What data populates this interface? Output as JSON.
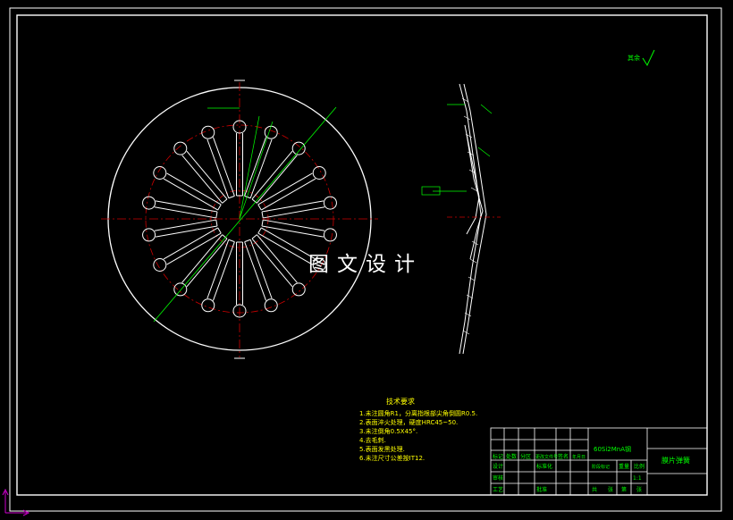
{
  "watermark": "图文设计",
  "roughness_note": "其余",
  "tech_req": {
    "title": "技术要求",
    "lines": [
      "1.未注圆角R1，分离指根部尖角倒圆R0.5.",
      "2.表面淬火处理，硬度HRC45~50.",
      "3.未注倒角0.5X45°.",
      "4.去毛刺.",
      "5.表面发黑处理.",
      "6.未注尺寸公差按IT12."
    ]
  },
  "title_block": {
    "material": "60Si2MnA钢",
    "part_name": "膜片弹簧",
    "scale": "1:1",
    "labels": [
      "标记",
      "处数",
      "分区",
      "更改文件号",
      "签名",
      "年月日",
      "设计",
      "标准化",
      "审核",
      "工艺",
      "批准",
      "阶段标记",
      "重量",
      "比例",
      "共",
      "张",
      "第",
      "张"
    ]
  },
  "colors": {
    "background": "#000000",
    "outline": "#ffffff",
    "center_line": "#cc0000",
    "dimension": "#00ff00",
    "text": "#ffff00",
    "axis_icon": "#cc00cc"
  }
}
